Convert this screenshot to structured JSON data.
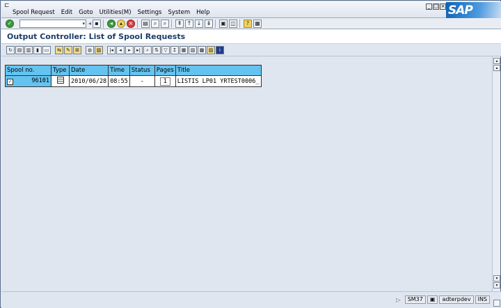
{
  "menu": {
    "items": [
      {
        "label": "Spool Request"
      },
      {
        "label": "Edit"
      },
      {
        "label": "Goto"
      },
      {
        "label": "Utilities(M)"
      },
      {
        "label": "Settings"
      },
      {
        "label": "System"
      },
      {
        "label": "Help"
      }
    ]
  },
  "brand": {
    "logo_text": "SAP"
  },
  "page": {
    "title": "Output Controller: List of Spool Requests"
  },
  "table": {
    "columns": [
      "Spool no.",
      "Type",
      "Date",
      "Time",
      "Status",
      "Pages",
      "Title"
    ],
    "rows": [
      {
        "spool_no": "96101",
        "date": "2010/06/28",
        "time": "08:55",
        "status": "-",
        "pages": "1",
        "title": "LISTIS LP01 YRTEST0006_"
      }
    ]
  },
  "statusbar": {
    "transaction": "SM37",
    "user": "adterpdev",
    "mode": "INS"
  },
  "colors": {
    "header_bg": "#64c3f0",
    "title_color": "#1a3c6a",
    "sap_blue": "#0b63b5"
  }
}
